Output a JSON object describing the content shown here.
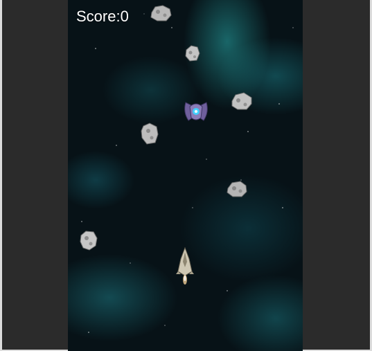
{
  "hud": {
    "score_label": "Score:",
    "score_value": "0"
  },
  "colors": {
    "background_outer": "#2b2b2b",
    "space_base": "#071217",
    "nebula": "#1f9a9a",
    "asteroid": "#bdbdbd",
    "enemy_ship": "#7a6aa8",
    "player_ship": "#c9c3b0"
  }
}
